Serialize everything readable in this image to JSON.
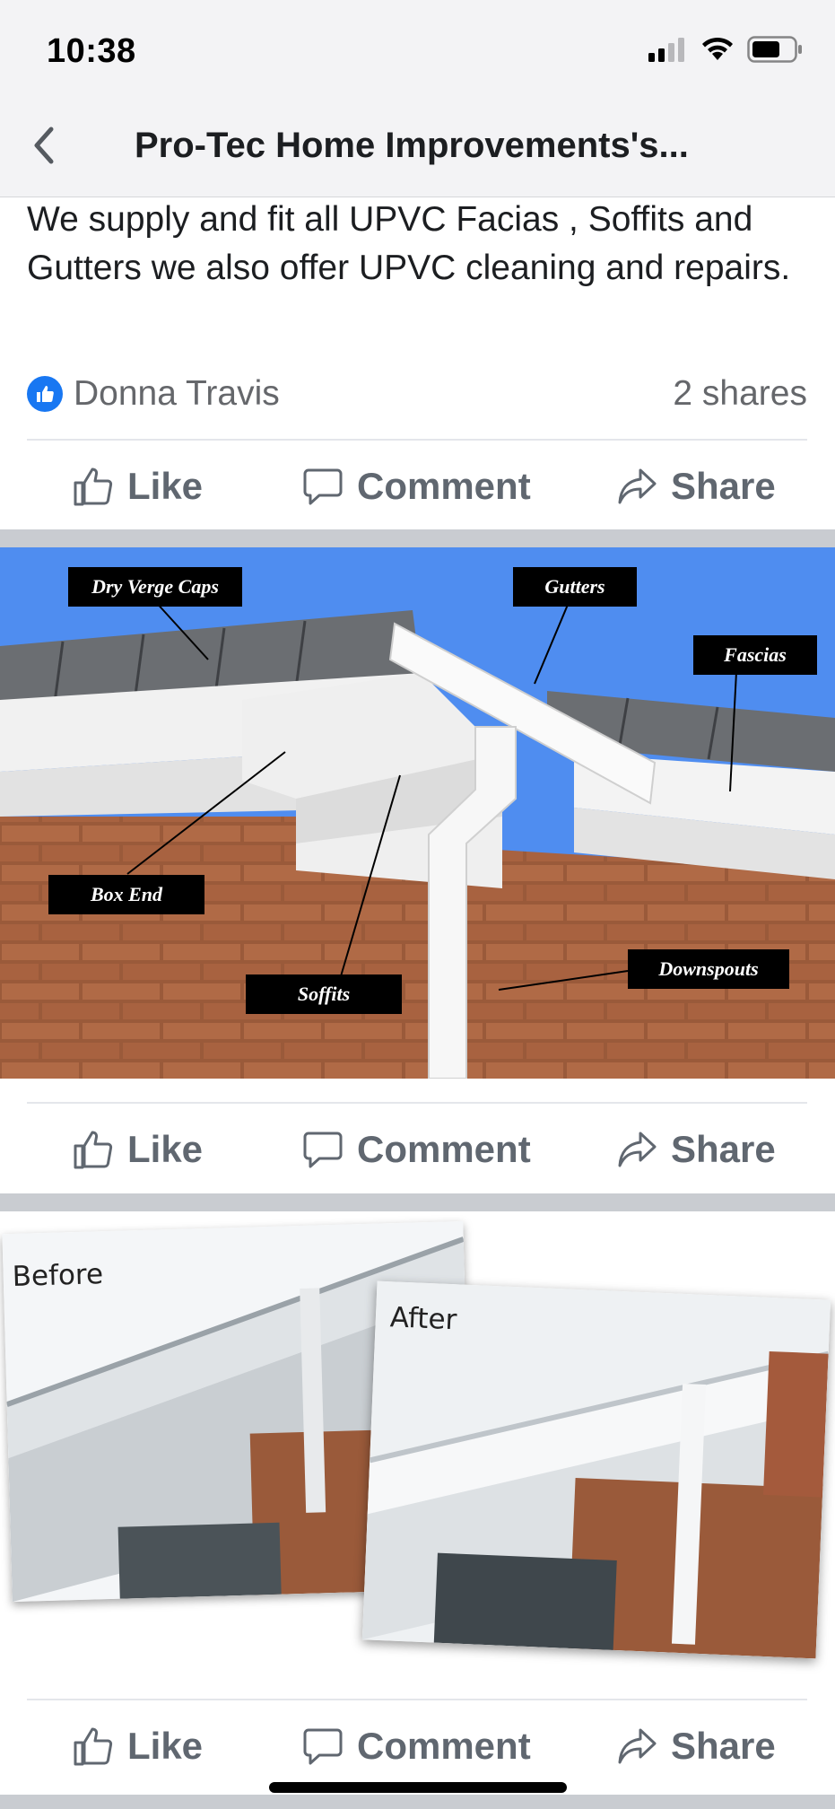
{
  "status": {
    "time": "10:38",
    "icons": [
      "signal-icon",
      "wifi-icon",
      "battery-icon"
    ]
  },
  "nav": {
    "back_icon": "chevron-left-icon",
    "title": "Pro-Tec Home Improvements's..."
  },
  "post": {
    "text": "We supply and fit all UPVC Facias , Soffits and Gutters we also offer UPVC cleaning and repairs.",
    "reactor": "Donna Travis",
    "shares": "2 shares"
  },
  "actions": {
    "like": "Like",
    "comment": "Comment",
    "share": "Share"
  },
  "photo1": {
    "labels": {
      "dry_verge_caps": "Dry Verge Caps",
      "gutters": "Gutters",
      "fascias": "Fascias",
      "box_end": "Box End",
      "soffits": "Soffits",
      "downspouts": "Downspouts"
    },
    "colors": {
      "sky": "#4f8df0",
      "brick": "#9a5a3a",
      "roof": "#6b6e72"
    }
  },
  "photo2": {
    "before_label": "Before",
    "after_label": "After"
  },
  "colors": {
    "accent": "#1877f2",
    "action_text": "#606770",
    "secondary_text": "#65676b",
    "separator": "#c9ccd1"
  }
}
